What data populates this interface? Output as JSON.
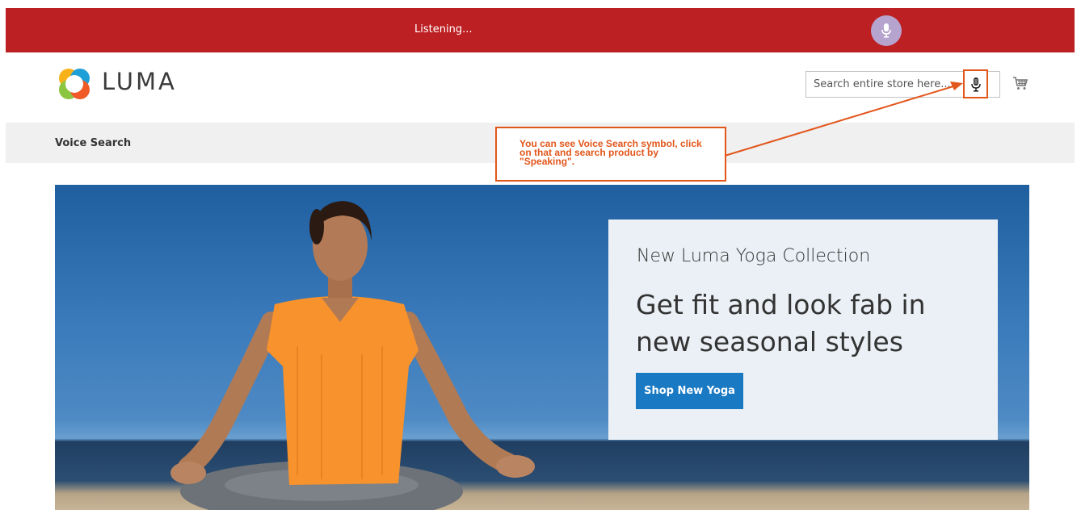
{
  "listening_bar": {
    "status_text": "Listening...",
    "mic_icon": "microphone-icon",
    "color": "#bd2023"
  },
  "header": {
    "logo_text": "LUMA",
    "logo_icon": "luma-logo-icon",
    "search": {
      "placeholder": "Search entire store here...",
      "value": ""
    },
    "voice_search_icon": "microphone-icon",
    "cart_icon": "shopping-cart-icon"
  },
  "nav": {
    "items": [
      {
        "label": "Voice Search"
      }
    ]
  },
  "annotation": {
    "text": "You can see Voice Search symbol, click on that and search product by \"Speaking\".",
    "color": "#e2561b"
  },
  "hero": {
    "subtitle": "New Luma Yoga Collection",
    "title": "Get fit and look fab in new seasonal styles",
    "button_label": "Shop New Yoga",
    "button_color": "#1979c3"
  }
}
